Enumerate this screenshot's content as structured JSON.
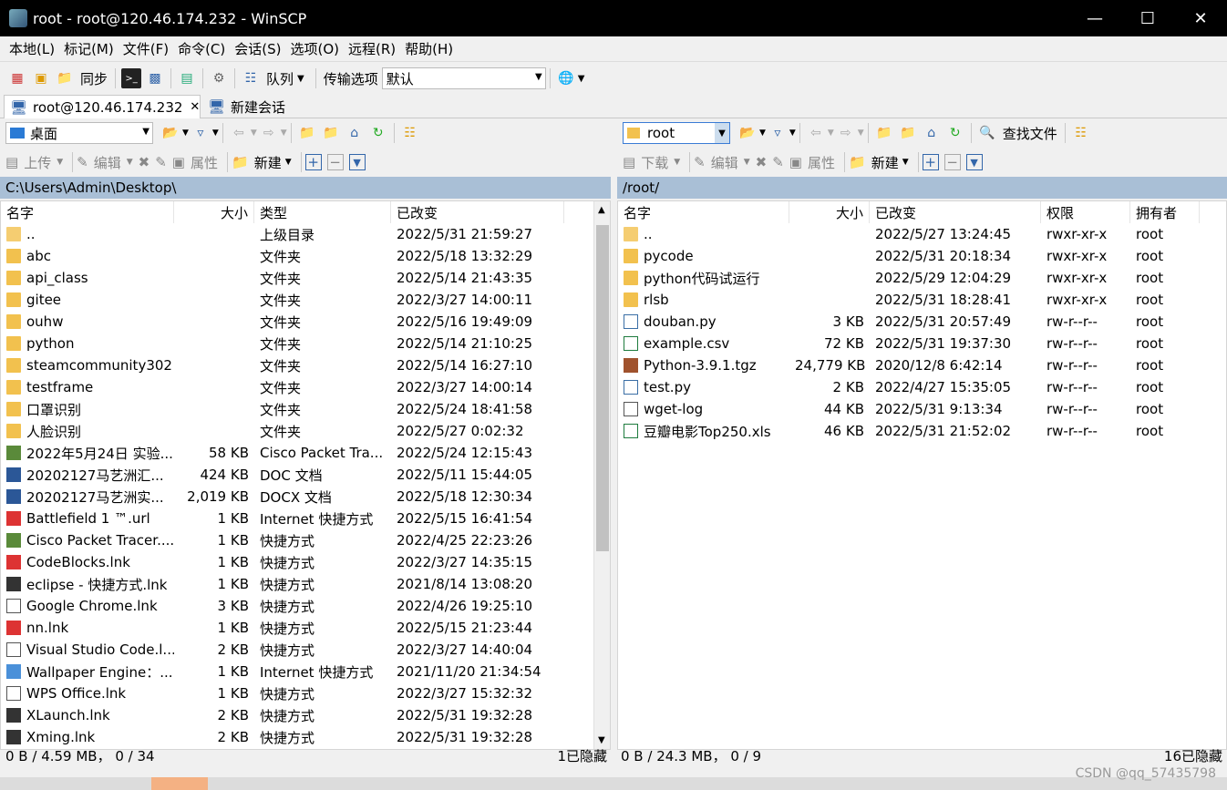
{
  "window": {
    "title": "root - root@120.46.174.232 - WinSCP"
  },
  "menu": [
    "本地(L)",
    "标记(M)",
    "文件(F)",
    "命令(C)",
    "会话(S)",
    "选项(O)",
    "远程(R)",
    "帮助(H)"
  ],
  "toolbar": {
    "sync_label": "同步",
    "queue_label": "队列",
    "transfer_label": "传输选项",
    "transfer_value": "默认"
  },
  "tabs": {
    "session": "root@120.46.174.232",
    "new_session": "新建会话"
  },
  "left": {
    "location": "桌面",
    "actions": {
      "upload": "上传",
      "edit": "编辑",
      "props": "属性",
      "new": "新建"
    },
    "path": "C:\\Users\\Admin\\Desktop\\",
    "columns": {
      "name": "名字",
      "size": "大小",
      "type": "类型",
      "changed": "已改变"
    },
    "rows": [
      {
        "icon": "updir",
        "name": "..",
        "size": "",
        "type": "上级目录",
        "changed": "2022/5/31  21:59:27"
      },
      {
        "icon": "folder",
        "name": "abc",
        "size": "",
        "type": "文件夹",
        "changed": "2022/5/18  13:32:29"
      },
      {
        "icon": "folder",
        "name": "api_class",
        "size": "",
        "type": "文件夹",
        "changed": "2022/5/14  21:43:35"
      },
      {
        "icon": "folder",
        "name": "gitee",
        "size": "",
        "type": "文件夹",
        "changed": "2022/3/27  14:00:11"
      },
      {
        "icon": "folder",
        "name": "ouhw",
        "size": "",
        "type": "文件夹",
        "changed": "2022/5/16  19:49:09"
      },
      {
        "icon": "folder",
        "name": "python",
        "size": "",
        "type": "文件夹",
        "changed": "2022/5/14  21:10:25"
      },
      {
        "icon": "folder",
        "name": "steamcommunity302",
        "size": "",
        "type": "文件夹",
        "changed": "2022/5/14  16:27:10"
      },
      {
        "icon": "folder",
        "name": "testframe",
        "size": "",
        "type": "文件夹",
        "changed": "2022/3/27  14:00:14"
      },
      {
        "icon": "folder",
        "name": "口罩识别",
        "size": "",
        "type": "文件夹",
        "changed": "2022/5/24  18:41:58"
      },
      {
        "icon": "folder",
        "name": "人脸识别",
        "size": "",
        "type": "文件夹",
        "changed": "2022/5/27  0:02:32"
      },
      {
        "icon": "pkt",
        "name": "2022年5月24日 实验...",
        "size": "58 KB",
        "type": "Cisco Packet Tra...",
        "changed": "2022/5/24  12:15:43"
      },
      {
        "icon": "word",
        "name": "20202127马艺洲汇...",
        "size": "424 KB",
        "type": "DOC 文档",
        "changed": "2022/5/11  15:44:05"
      },
      {
        "icon": "word",
        "name": "20202127马艺洲实...",
        "size": "2,019 KB",
        "type": "DOCX 文档",
        "changed": "2022/5/18  12:30:34"
      },
      {
        "icon": "red",
        "name": "Battlefield 1 ™.url",
        "size": "1 KB",
        "type": "Internet 快捷方式",
        "changed": "2022/5/15  16:41:54"
      },
      {
        "icon": "pkt",
        "name": "Cisco Packet Tracer....",
        "size": "1 KB",
        "type": "快捷方式",
        "changed": "2022/4/25  22:23:26"
      },
      {
        "icon": "red",
        "name": "CodeBlocks.lnk",
        "size": "1 KB",
        "type": "快捷方式",
        "changed": "2022/3/27  14:35:15"
      },
      {
        "icon": "dark",
        "name": "eclipse - 快捷方式.lnk",
        "size": "1 KB",
        "type": "快捷方式",
        "changed": "2021/8/14  13:08:20"
      },
      {
        "icon": "doc",
        "name": "Google Chrome.lnk",
        "size": "3 KB",
        "type": "快捷方式",
        "changed": "2022/4/26  19:25:10"
      },
      {
        "icon": "red",
        "name": "nn.lnk",
        "size": "1 KB",
        "type": "快捷方式",
        "changed": "2022/5/15  21:23:44"
      },
      {
        "icon": "doc",
        "name": "Visual Studio Code.l...",
        "size": "2 KB",
        "type": "快捷方式",
        "changed": "2022/3/27  14:40:04"
      },
      {
        "icon": "lnk",
        "name": "Wallpaper Engine：...",
        "size": "1 KB",
        "type": "Internet 快捷方式",
        "changed": "2021/11/20  21:34:54"
      },
      {
        "icon": "doc",
        "name": "WPS Office.lnk",
        "size": "1 KB",
        "type": "快捷方式",
        "changed": "2022/3/27  15:32:32"
      },
      {
        "icon": "dark",
        "name": "XLaunch.lnk",
        "size": "2 KB",
        "type": "快捷方式",
        "changed": "2022/5/31  19:32:28"
      },
      {
        "icon": "dark",
        "name": "Xming.lnk",
        "size": "2 KB",
        "type": "快捷方式",
        "changed": "2022/5/31  19:32:28"
      }
    ],
    "status_left": "0 B / 4.59 MB，  0 / 34",
    "status_right": "1已隐藏"
  },
  "right": {
    "location": "root",
    "find_label": "查找文件",
    "actions": {
      "download": "下载",
      "edit": "编辑",
      "props": "属性",
      "new": "新建"
    },
    "path": "/root/",
    "columns": {
      "name": "名字",
      "size": "大小",
      "changed": "已改变",
      "rights": "权限",
      "owner": "拥有者"
    },
    "rows": [
      {
        "icon": "updir",
        "name": "..",
        "size": "",
        "changed": "2022/5/27 13:24:45",
        "rights": "rwxr-xr-x",
        "owner": "root"
      },
      {
        "icon": "folder",
        "name": "pycode",
        "size": "",
        "changed": "2022/5/31 20:18:34",
        "rights": "rwxr-xr-x",
        "owner": "root"
      },
      {
        "icon": "folder",
        "name": "python代码试运行",
        "size": "",
        "changed": "2022/5/29 12:04:29",
        "rights": "rwxr-xr-x",
        "owner": "root"
      },
      {
        "icon": "folder",
        "name": "rlsb",
        "size": "",
        "changed": "2022/5/31 18:28:41",
        "rights": "rwxr-xr-x",
        "owner": "root"
      },
      {
        "icon": "py",
        "name": "douban.py",
        "size": "3 KB",
        "changed": "2022/5/31 20:57:49",
        "rights": "rw-r--r--",
        "owner": "root"
      },
      {
        "icon": "csv",
        "name": "example.csv",
        "size": "72 KB",
        "changed": "2022/5/31 19:37:30",
        "rights": "rw-r--r--",
        "owner": "root"
      },
      {
        "icon": "tgz",
        "name": "Python-3.9.1.tgz",
        "size": "24,779 KB",
        "changed": "2020/12/8 6:42:14",
        "rights": "rw-r--r--",
        "owner": "root"
      },
      {
        "icon": "py",
        "name": "test.py",
        "size": "2 KB",
        "changed": "2022/4/27 15:35:05",
        "rights": "rw-r--r--",
        "owner": "root"
      },
      {
        "icon": "doc",
        "name": "wget-log",
        "size": "44 KB",
        "changed": "2022/5/31 9:13:34",
        "rights": "rw-r--r--",
        "owner": "root"
      },
      {
        "icon": "xls",
        "name": "豆瓣电影Top250.xls",
        "size": "46 KB",
        "changed": "2022/5/31 21:52:02",
        "rights": "rw-r--r--",
        "owner": "root"
      }
    ],
    "status_left": "0 B / 24.3 MB，  0 / 9",
    "status_right": "16已隐藏"
  },
  "watermark": "CSDN @qq_57435798"
}
